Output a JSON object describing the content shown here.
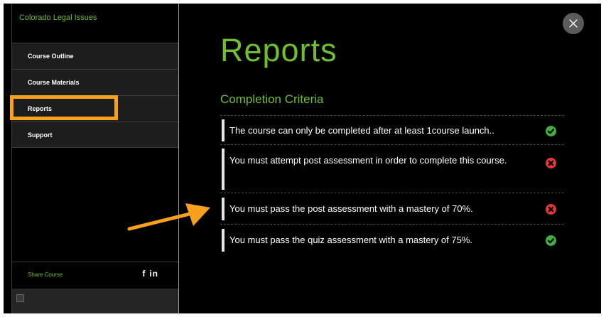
{
  "sidebar": {
    "title": "Colorado Legal Issues",
    "items": [
      {
        "label": "Course Outline"
      },
      {
        "label": "Course Materials"
      },
      {
        "label": "Reports"
      },
      {
        "label": "Support"
      }
    ],
    "share_label": "Share Course",
    "social": {
      "facebook": "f",
      "linkedin": "in"
    }
  },
  "main": {
    "title": "Reports",
    "section_title": "Completion Criteria",
    "criteria": [
      {
        "text": "The course can only be completed after at least 1course launch..",
        "status": "complete"
      },
      {
        "text": "You must attempt post assessment in order to complete this course.",
        "status": "incomplete"
      },
      {
        "text": "You must pass the post assessment with a mastery of 70%.",
        "status": "incomplete"
      },
      {
        "text": "You must pass the quiz assessment with a mastery of 75%.",
        "status": "complete"
      }
    ]
  },
  "colors": {
    "accent_green": "#6fbf2f",
    "highlight_orange": "#f7a01b",
    "check_green": "#3fae3f",
    "cross_red": "#e63737"
  },
  "icons": {
    "complete": "check-circle-icon",
    "incomplete": "x-circle-icon",
    "close": "close-icon",
    "annotation": "arrow-icon"
  }
}
